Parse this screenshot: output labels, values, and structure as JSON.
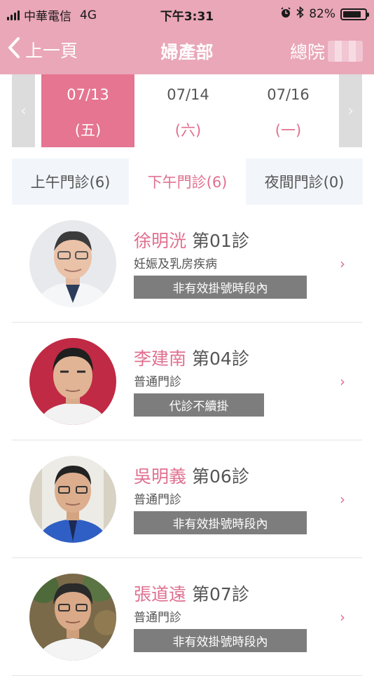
{
  "status_bar": {
    "carrier": "中華電信",
    "network": "4G",
    "time": "下午3:31",
    "battery": "82%",
    "battery_level": 0.82
  },
  "nav": {
    "back_label": "上一頁",
    "title": "婦產部",
    "right_label": "總院"
  },
  "dates": [
    {
      "date": "07/13",
      "weekday": "(五)",
      "selected": true
    },
    {
      "date": "07/14",
      "weekday": "(六)",
      "selected": false
    },
    {
      "date": "07/16",
      "weekday": "(一)",
      "selected": false
    }
  ],
  "session_tabs": [
    {
      "label": "上午門診(6)",
      "active": false
    },
    {
      "label": "下午門診(6)",
      "active": true
    },
    {
      "label": "夜間門診(0)",
      "active": false
    }
  ],
  "doctors": [
    {
      "name": "徐明洸",
      "room": "第01診",
      "specialty": "妊娠及乳房疾病",
      "status": "非有效掛號時段內"
    },
    {
      "name": "李建南",
      "room": "第04診",
      "specialty": "普通門診",
      "status": "代診不續掛"
    },
    {
      "name": "吳明義",
      "room": "第06診",
      "specialty": "普通門診",
      "status": "非有效掛號時段內"
    },
    {
      "name": "張道遠",
      "room": "第07診",
      "specialty": "普通門診",
      "status": "非有效掛號時段內"
    }
  ],
  "colors": {
    "header_bg": "#e9a7b8",
    "accent": "#e57590",
    "name_pink": "#e0708f",
    "status_gray": "#7d7d7d"
  },
  "icons": [
    "signal-icon",
    "alarm-icon",
    "bluetooth-icon",
    "battery-icon",
    "back-chevron-icon",
    "chevron-left-icon",
    "chevron-right-icon"
  ]
}
